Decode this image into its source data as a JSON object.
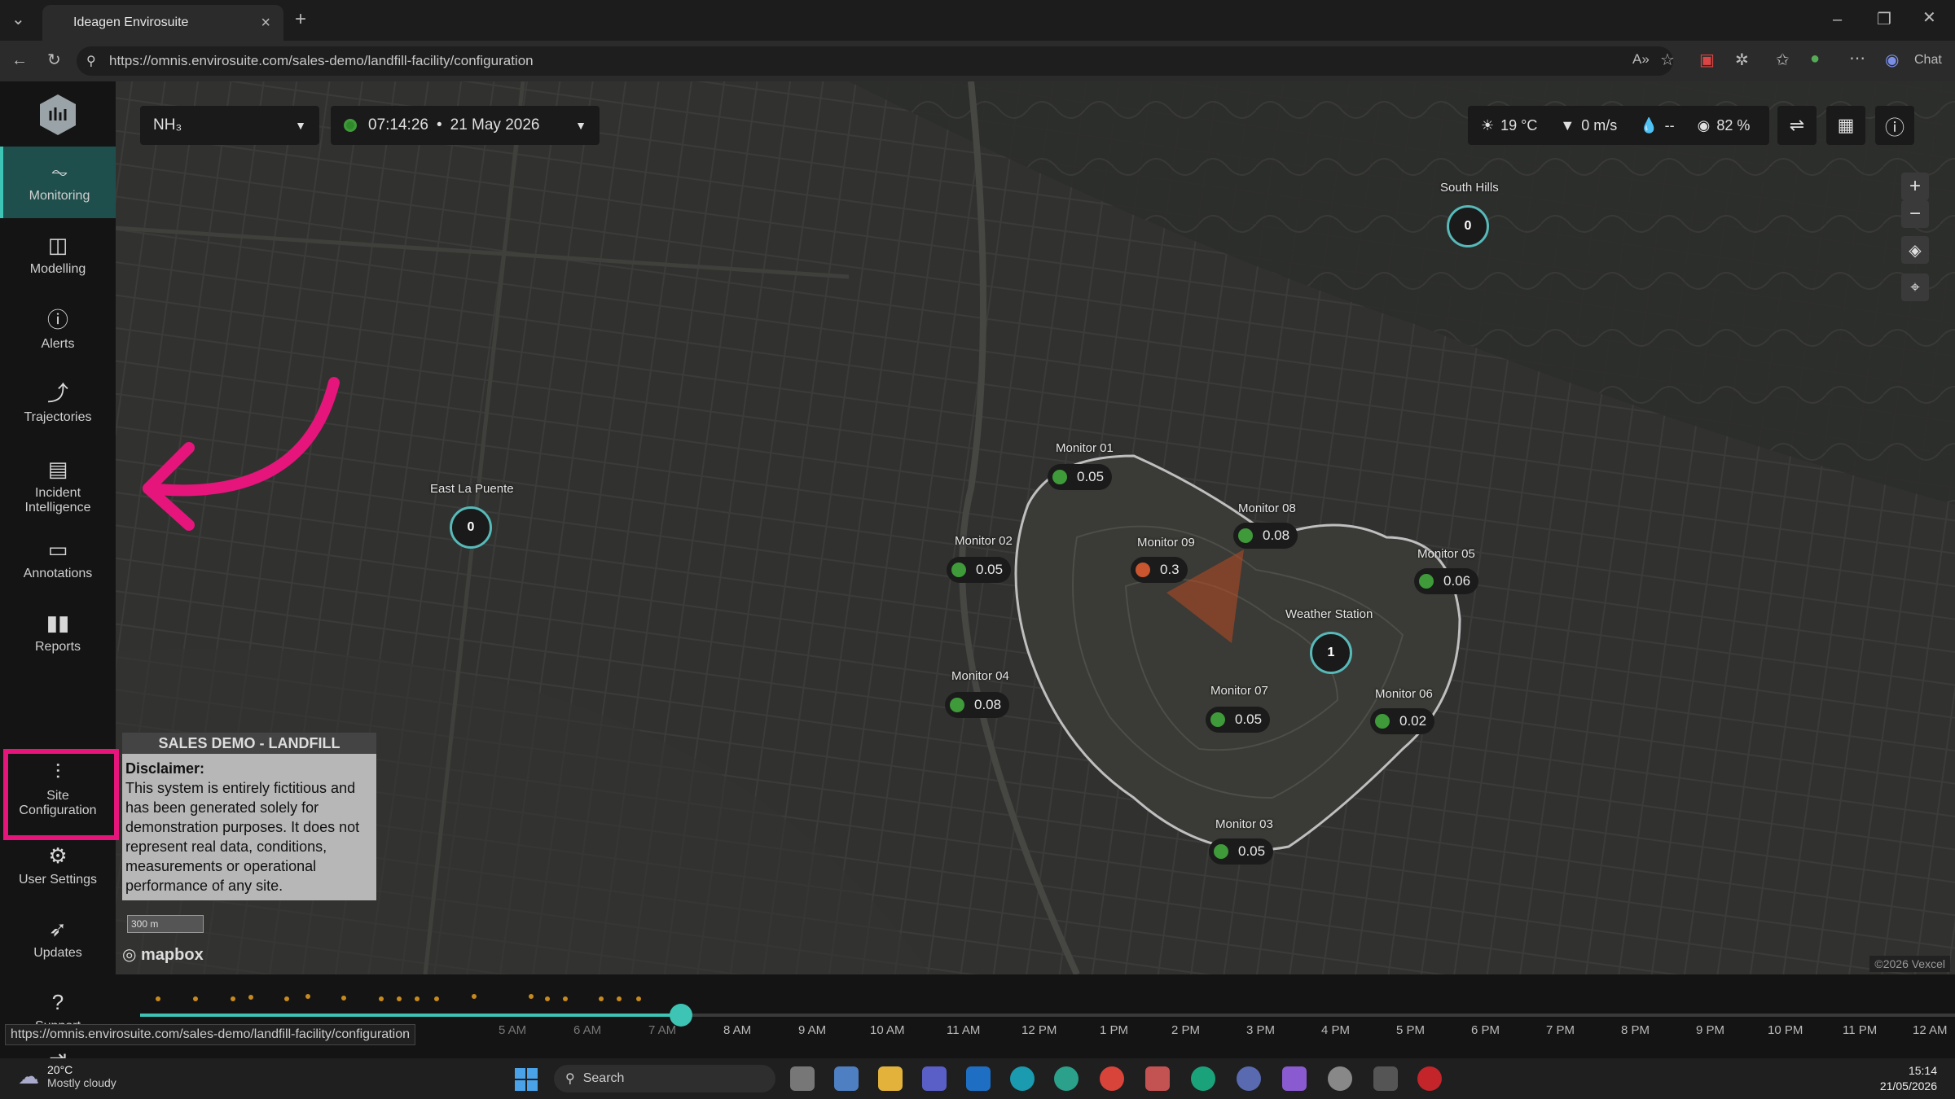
{
  "browser": {
    "tab_title": "Ideagen Envirosuite",
    "url": "https://omnis.envirosuite.com/sales-demo/landfill-facility/configuration",
    "status_url": "https://omnis.envirosuite.com/sales-demo/landfill-facility/configuration",
    "chat_label": "Chat"
  },
  "sidebar": {
    "items": [
      {
        "label": "Monitoring",
        "icon": "pulse-icon"
      },
      {
        "label": "Modelling",
        "icon": "grid-chart-icon"
      },
      {
        "label": "Alerts",
        "icon": "alert-circle-icon"
      },
      {
        "label": "Trajectories",
        "icon": "curve-icon"
      },
      {
        "label": "Incident Intelligence",
        "icon": "incident-icon"
      },
      {
        "label": "Annotations",
        "icon": "comment-icon"
      },
      {
        "label": "Reports",
        "icon": "bar-chart-icon"
      },
      {
        "label": "Site Configuration",
        "icon": "sliders-icon"
      },
      {
        "label": "User Settings",
        "icon": "gear-icon"
      },
      {
        "label": "Updates",
        "icon": "rocket-icon"
      },
      {
        "label": "Support",
        "icon": "help-icon"
      },
      {
        "label": "Logout",
        "icon": "logout-icon"
      }
    ]
  },
  "toolbar": {
    "pollutant": "NH₃",
    "time": "07:14:26",
    "date": "21 May 2026",
    "temperature": "19 °C",
    "wind": "0 m/s",
    "rain": "--",
    "humidity": "82 %"
  },
  "map": {
    "places": {
      "east_la_puente": "East La Puente",
      "south_hills": "South Hills",
      "weather_station": "Weather Station"
    },
    "markers": {
      "east_la_puente_val": "0",
      "south_hills_val": "0",
      "weather_station_val": "1"
    },
    "monitors": [
      {
        "name": "Monitor 01",
        "value": "0.05"
      },
      {
        "name": "Monitor 02",
        "value": "0.05"
      },
      {
        "name": "Monitor 03",
        "value": "0.05"
      },
      {
        "name": "Monitor 04",
        "value": "0.08"
      },
      {
        "name": "Monitor 05",
        "value": "0.06"
      },
      {
        "name": "Monitor 06",
        "value": "0.02"
      },
      {
        "name": "Monitor 07",
        "value": "0.05"
      },
      {
        "name": "Monitor 08",
        "value": "0.08"
      },
      {
        "name": "Monitor 09",
        "value": "0.3"
      }
    ],
    "scale": "300 m",
    "attribution_logo": "mapbox",
    "copyright": "©2026 Vexcel"
  },
  "disclaimer": {
    "site_name": "SALES DEMO - LANDFILL",
    "heading": "Disclaimer:",
    "body": "This system is entirely fictitious and has been generated solely for demonstration purposes. It does not represent real data, conditions, measurements or operational performance of any site."
  },
  "timeline": {
    "ticks": [
      "5 AM",
      "6 AM",
      "7 AM",
      "8 AM",
      "9 AM",
      "10 AM",
      "11 AM",
      "12 PM",
      "1 PM",
      "2 PM",
      "3 PM",
      "4 PM",
      "5 PM",
      "6 PM",
      "7 PM",
      "8 PM",
      "9 PM",
      "10 PM",
      "11 PM",
      "12 AM"
    ]
  },
  "taskbar": {
    "weather_temp": "20°C",
    "weather_desc": "Mostly cloudy",
    "search_placeholder": "Search",
    "clock_time": "15:14",
    "clock_date": "21/05/2026"
  },
  "colors": {
    "accent": "#3ec4b4",
    "highlight": "#e5157b",
    "status_ok": "#3f9a3a",
    "status_warn": "#c9562f"
  }
}
